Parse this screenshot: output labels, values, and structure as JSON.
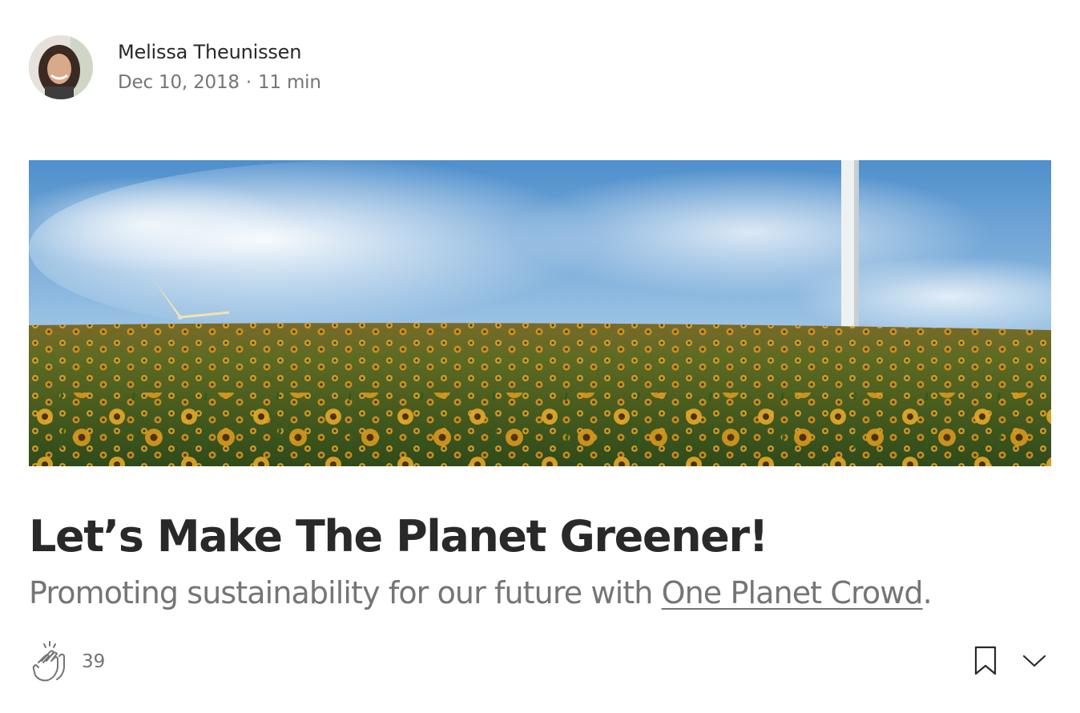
{
  "author": {
    "name": "Melissa Theunissen",
    "date": "Dec 10, 2018",
    "separator": "·",
    "read_time": "11 min"
  },
  "article": {
    "title": "Let’s Make The Planet Greener!",
    "subtitle_prefix": "Promoting sustainability for our future with ",
    "subtitle_link": "One Planet Crowd",
    "subtitle_suffix": "."
  },
  "actions": {
    "clap_count": "39",
    "clap_icon": "clap-icon",
    "bookmark_icon": "bookmark-icon",
    "more_icon": "chevron-down-icon"
  },
  "colors": {
    "text_primary": "#292929",
    "text_secondary": "#757575",
    "background": "#ffffff"
  }
}
